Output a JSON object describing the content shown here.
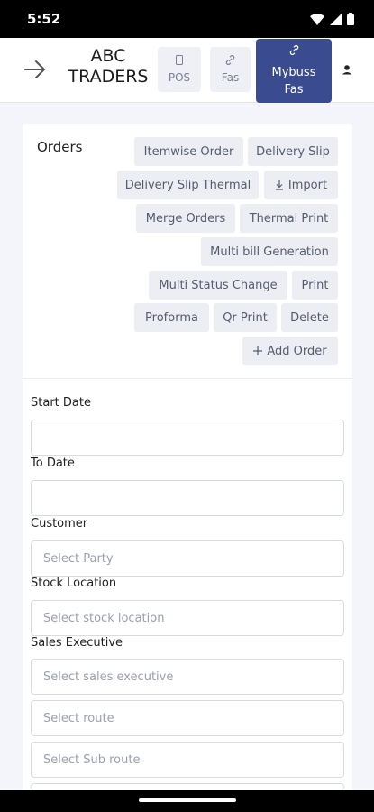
{
  "status_bar": {
    "time": "5:52"
  },
  "header": {
    "brand_line1": "ABC",
    "brand_line2": "TRADERS",
    "pos_label": "POS",
    "fas_label": "Fas",
    "mybuss_line1": "Mybuss",
    "mybuss_line2": "Fas",
    "accent_color": "#3b4b8f"
  },
  "orders": {
    "title": "Orders",
    "actions": [
      "Itemwise Order",
      "Delivery Slip",
      "Delivery Slip Thermal",
      "Import",
      "Merge Orders",
      "Thermal Print",
      "Multi bill Generation",
      "Multi Status Change",
      "Print",
      "Proforma",
      "Qr Print",
      "Delete",
      "Add Order"
    ]
  },
  "filters": {
    "start_date_label": "Start Date",
    "to_date_label": "To Date",
    "customer_label": "Customer",
    "customer_placeholder": "Select Party",
    "stock_location_label": "Stock Location",
    "stock_location_placeholder": "Select stock location",
    "sales_executive_label": "Sales Executive",
    "sales_executive_placeholder": "Select sales executive",
    "route_placeholder": "Select route",
    "sub_route_placeholder": "Select Sub route"
  }
}
